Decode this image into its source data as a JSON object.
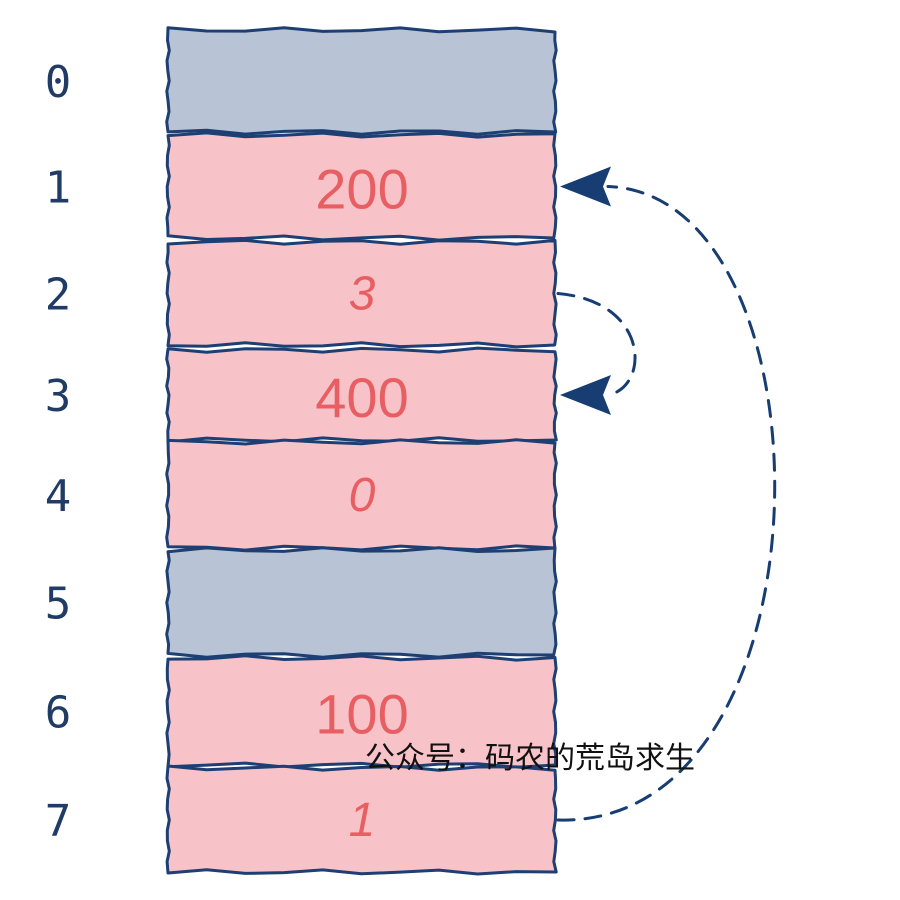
{
  "diagram": {
    "watermark": "公众号：码农的荒岛求生",
    "colors": {
      "filled": "#f8c3c8",
      "empty": "#b8c3d5",
      "border": "#1d3f73",
      "value_text": "#e85f63",
      "index_text": "#1f3b66",
      "arrow": "#173d73"
    },
    "cells": [
      {
        "index": "0",
        "value": "",
        "state": "empty",
        "italic": false
      },
      {
        "index": "1",
        "value": "200",
        "state": "filled",
        "italic": false
      },
      {
        "index": "2",
        "value": "3",
        "state": "filled",
        "italic": true
      },
      {
        "index": "3",
        "value": "400",
        "state": "filled",
        "italic": false
      },
      {
        "index": "4",
        "value": "0",
        "state": "filled",
        "italic": true
      },
      {
        "index": "5",
        "value": "",
        "state": "empty",
        "italic": false
      },
      {
        "index": "6",
        "value": "100",
        "state": "filled",
        "italic": false
      },
      {
        "index": "7",
        "value": "1",
        "state": "filled",
        "italic": true
      }
    ],
    "links": [
      {
        "from": "2",
        "to": "3"
      },
      {
        "from": "7",
        "to": "1"
      }
    ]
  }
}
